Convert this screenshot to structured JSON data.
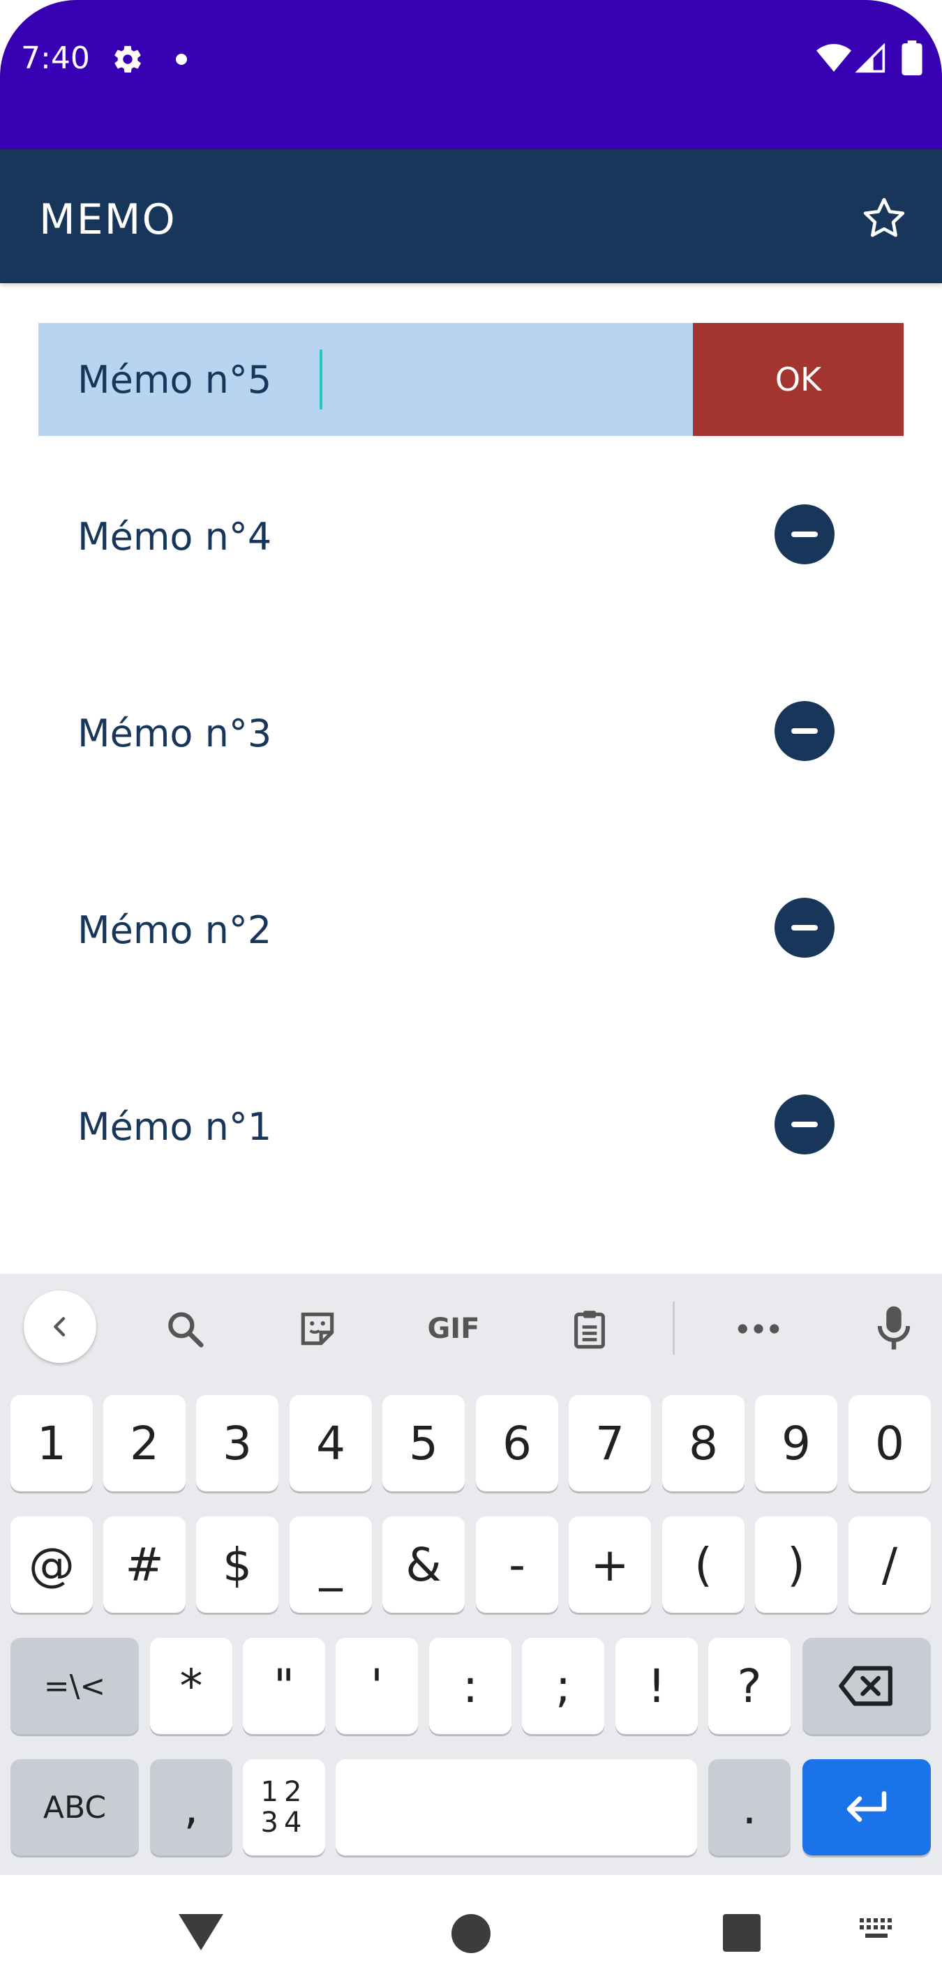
{
  "status_bar": {
    "time": "7:40",
    "icons": [
      "gear-icon",
      "notification-dot-icon",
      "wifi-icon",
      "signal-icon",
      "battery-icon"
    ]
  },
  "app_bar": {
    "title": "MEMO",
    "star_icon": "star-outline-icon"
  },
  "input": {
    "value": "Mémo n°5",
    "ok_label": "OK"
  },
  "memos": [
    {
      "label": "Mémo n°4"
    },
    {
      "label": "Mémo n°3"
    },
    {
      "label": "Mémo n°2"
    },
    {
      "label": "Mémo n°1"
    }
  ],
  "keyboard": {
    "toolbar": {
      "gif_label": "GIF",
      "icons": [
        "chevron-left-icon",
        "search-icon",
        "sticker-icon",
        "gif-icon",
        "clipboard-icon",
        "more-icon",
        "microphone-icon"
      ]
    },
    "row1": [
      "1",
      "2",
      "3",
      "4",
      "5",
      "6",
      "7",
      "8",
      "9",
      "0"
    ],
    "row2": [
      "@",
      "#",
      "$",
      "_",
      "&",
      "-",
      "+",
      "(",
      ")",
      "/"
    ],
    "row3": [
      "=\\<",
      "*",
      "\"",
      "'",
      ":",
      ";",
      "!",
      "?"
    ],
    "row4": {
      "abc": "ABC",
      "comma": ",",
      "numbers_top": "12",
      "numbers_bottom": "34",
      "period": "."
    }
  },
  "colors": {
    "status_bar": "#3700b3",
    "app_bar": "#17365a",
    "input_bg": "#b7d5f1",
    "ok_button": "#a3352e",
    "enter_key": "#1a73e8"
  }
}
